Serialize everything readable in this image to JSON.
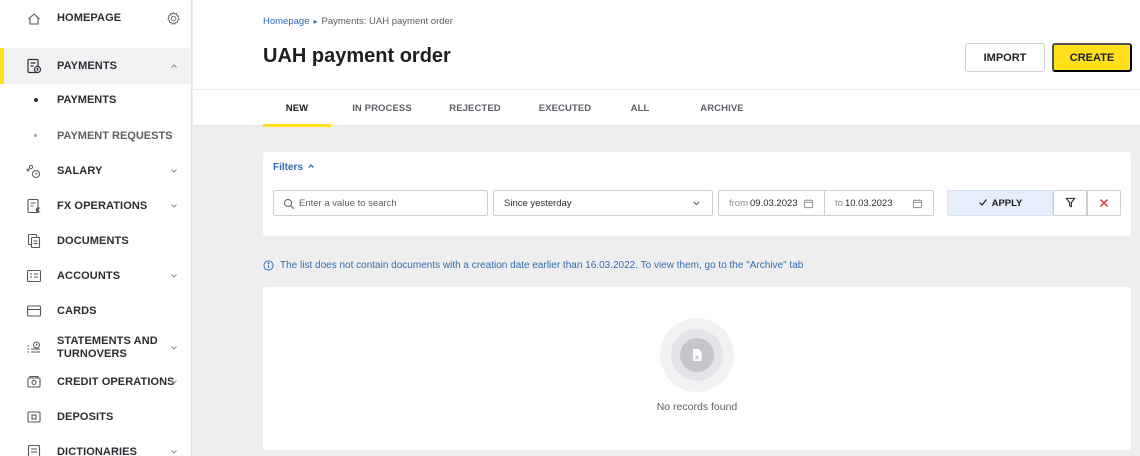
{
  "sidebar": {
    "items": [
      {
        "label": "HOMEPAGE",
        "icon": "home-icon"
      },
      {
        "label": "PAYMENTS",
        "icon": "payments-icon",
        "expanded": true
      },
      {
        "label": "PAYMENTS",
        "sub": true
      },
      {
        "label": "PAYMENT REQUESTS",
        "sub": true
      },
      {
        "label": "SALARY",
        "icon": "salary-icon"
      },
      {
        "label": "FX OPERATIONS",
        "icon": "fx-icon"
      },
      {
        "label": "DOCUMENTS",
        "icon": "documents-icon"
      },
      {
        "label": "ACCOUNTS",
        "icon": "accounts-icon"
      },
      {
        "label": "CARDS",
        "icon": "card-icon"
      },
      {
        "label_line1": "STATEMENTS AND",
        "label_line2": "TURNOVERS",
        "icon": "statements-icon"
      },
      {
        "label": "CREDIT OPERATIONS",
        "icon": "credit-icon"
      },
      {
        "label": "DEPOSITS",
        "icon": "deposits-icon"
      },
      {
        "label": "DICTIONARIES",
        "icon": "dictionaries-icon"
      }
    ]
  },
  "header": {
    "breadcrumb": {
      "home": "Homepage",
      "current": "Payments: UAH payment order"
    },
    "title": "UAH payment order",
    "import_label": "IMPORT",
    "create_label": "CREATE"
  },
  "tabs": [
    {
      "label": "NEW",
      "active": true
    },
    {
      "label": "IN PROCESS"
    },
    {
      "label": "REJECTED"
    },
    {
      "label": "EXECUTED"
    },
    {
      "label": "ALL"
    },
    {
      "label": "ARCHIVE"
    }
  ],
  "filters": {
    "toggle_label": "Filters",
    "search_placeholder": "Enter a value to search",
    "period_value": "Since yesterday",
    "from_prefix": "from",
    "from_value": "09.03.2023",
    "to_prefix": "to",
    "to_value": "10.03.2023",
    "apply_label": "APPLY"
  },
  "notice": "The list does not contain documents with a creation date earlier than 16.03.2022. To view them, go to the \"Archive\" tab",
  "empty_state": {
    "text": "No records found"
  },
  "colors": {
    "accent": "#ffe01a",
    "link": "#2e6db4",
    "danger": "#e0373e"
  }
}
